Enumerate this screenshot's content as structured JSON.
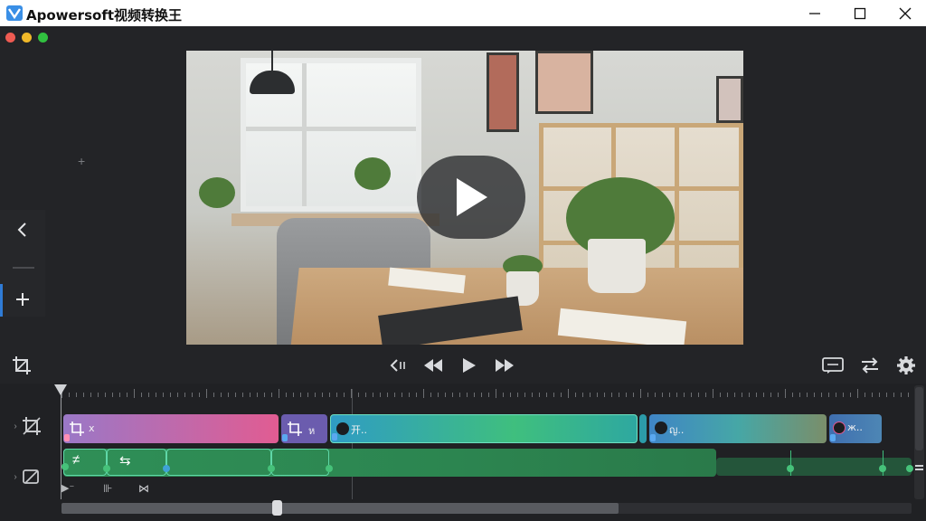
{
  "app": {
    "title": "Apowersoft视频转换王"
  },
  "window_controls": {
    "minimize": "minimize",
    "maximize": "maximize",
    "close": "close"
  },
  "colors": {
    "accent": "#2f7bd6",
    "traffic_red": "#ee5b52",
    "traffic_yellow": "#f0b829",
    "traffic_green": "#31c140",
    "clip_pink_start": "#a06fc0",
    "clip_pink_end": "#e0568f",
    "clip_purple": "#6a5aa8",
    "clip_teal": "#2aa3c0",
    "clip_green": "#3fb86a",
    "audio_green": "#2f8f57"
  },
  "timeline": {
    "video_clips": [
      {
        "label": "x"
      },
      {
        "label": "ห"
      },
      {
        "label": "开.."
      },
      {
        "label": "Ⱈ.."
      },
      {
        "label": "ญ.."
      },
      {
        "label": "ж.."
      }
    ],
    "audio_icons": [
      "≠",
      "⇆"
    ],
    "extra_icons": [
      "▶⁻",
      "⊪",
      "⋈"
    ],
    "horizontal_scroll": 0.25
  },
  "icons": {
    "crop": "crop-icon",
    "back": "chevron-left-icon",
    "add": "plus-icon",
    "rewind": "rewind-icon",
    "play": "play-icon",
    "fast_forward": "fast-forward-icon",
    "undo_special": "reverse-icon",
    "caption": "caption-icon",
    "swap": "swap-icon",
    "settings": "gear-icon"
  }
}
